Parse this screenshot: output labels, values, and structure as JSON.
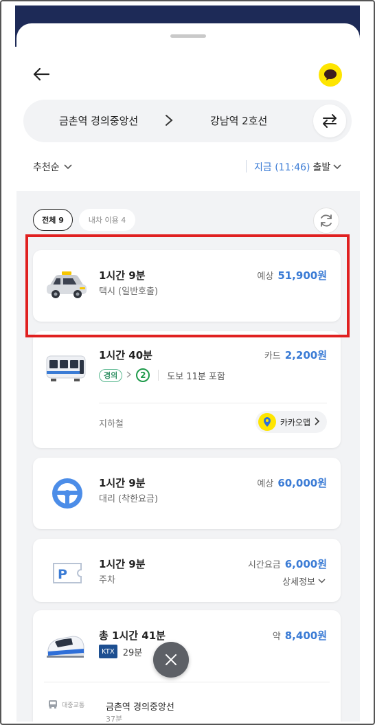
{
  "header": {
    "origin": "금촌역 경의중앙선",
    "destination": "강남역 2호선"
  },
  "filters": {
    "sort_label": "추천순",
    "depart_time": "지금 (11:46)",
    "depart_label": "출발"
  },
  "chips": {
    "all": "전체 9",
    "car": "내차 이용 4"
  },
  "cards": {
    "taxi": {
      "duration": "1시간 9분",
      "sub": "택시 (일반호출)",
      "price_label": "예상",
      "price": "51,900원"
    },
    "subway": {
      "duration": "1시간 40분",
      "price_label": "카드",
      "price": "2,200원",
      "line1": "경의",
      "line2": "2",
      "walk": "도보 11분 포함",
      "mode": "지하철",
      "kakaomap": "카카오맵"
    },
    "driver": {
      "duration": "1시간 9분",
      "sub": "대리 (착한요금)",
      "price_label": "예상",
      "price": "60,000원"
    },
    "parking": {
      "duration": "1시간 9분",
      "sub": "주차",
      "price_label": "시간요금",
      "price": "6,000원",
      "detail": "상세정보"
    },
    "ktx": {
      "duration": "총 1시간 41분",
      "price_label": "약",
      "price": "8,400원",
      "ktx_badge": "KTX",
      "ktx_time": "29분",
      "transit_label": "대중교통",
      "step_title": "금촌역 경의중앙선",
      "step_time": "37분"
    }
  },
  "colors": {
    "accent": "#3a7bd5",
    "kakao_yellow": "#fee500",
    "highlight_red": "#e02020",
    "navy": "#1d2a57"
  }
}
